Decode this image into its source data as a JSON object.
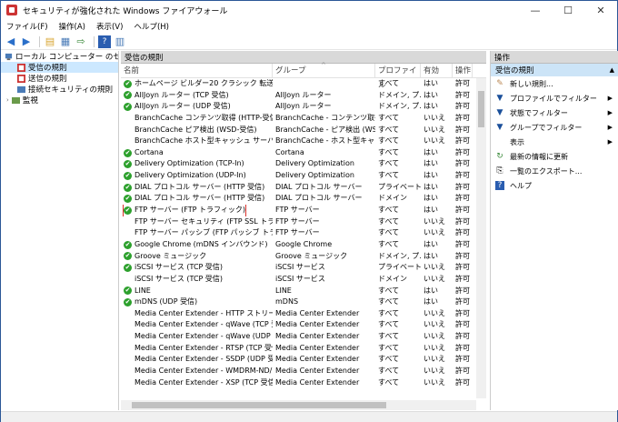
{
  "window": {
    "title": "セキュリティが強化された Windows ファイアウォール",
    "minimize": "—",
    "maximize": "☐",
    "close": "✕"
  },
  "menu": [
    "ファイル(F)",
    "操作(A)",
    "表示(V)",
    "ヘルプ(H)"
  ],
  "tree": {
    "root": "ローカル コンピューター のセキュリティ",
    "items": [
      "受信の規則",
      "送信の規則",
      "接続セキュリティの規則",
      "監視"
    ]
  },
  "center": {
    "header": "受信の規則",
    "columns": {
      "name": "名前",
      "group": "グループ",
      "profile": "プロファイル",
      "enabled": "有効",
      "action": "操作"
    },
    "sort_mark": "^",
    "rows": [
      {
        "enabled_icon": true,
        "name": "ホームページ ビルダー20 クラシック 転送予約ブ...",
        "group": "",
        "profile": "すべて",
        "enabled": "はい",
        "action": "許可"
      },
      {
        "enabled_icon": true,
        "name": "AllJoyn ルーター (TCP 受信)",
        "group": "AllJoyn ルーター",
        "profile": "ドメイン, プ...",
        "enabled": "はい",
        "action": "許可"
      },
      {
        "enabled_icon": true,
        "name": "AllJoyn ルーター (UDP 受信)",
        "group": "AllJoyn ルーター",
        "profile": "ドメイン, プ...",
        "enabled": "はい",
        "action": "許可"
      },
      {
        "enabled_icon": false,
        "name": "BranchCache コンテンツ取得 (HTTP-受信)",
        "group": "BranchCache - コンテンツ取得...",
        "profile": "すべて",
        "enabled": "いいえ",
        "action": "許可"
      },
      {
        "enabled_icon": false,
        "name": "BranchCache ピア検出 (WSD-受信)",
        "group": "BranchCache - ピア検出 (WS...",
        "profile": "すべて",
        "enabled": "いいえ",
        "action": "許可"
      },
      {
        "enabled_icon": false,
        "name": "BranchCache ホスト型キャッシュ サーバー (HT...",
        "group": "BranchCache - ホスト型キャッ...",
        "profile": "すべて",
        "enabled": "いいえ",
        "action": "許可"
      },
      {
        "enabled_icon": true,
        "name": "Cortana",
        "group": "Cortana",
        "profile": "すべて",
        "enabled": "はい",
        "action": "許可"
      },
      {
        "enabled_icon": true,
        "name": "Delivery Optimization (TCP-In)",
        "group": "Delivery Optimization",
        "profile": "すべて",
        "enabled": "はい",
        "action": "許可"
      },
      {
        "enabled_icon": true,
        "name": "Delivery Optimization (UDP-In)",
        "group": "Delivery Optimization",
        "profile": "すべて",
        "enabled": "はい",
        "action": "許可"
      },
      {
        "enabled_icon": true,
        "name": "DIAL プロトコル サーバー (HTTP 受信)",
        "group": "DIAL プロトコル サーバー",
        "profile": "プライベート",
        "enabled": "はい",
        "action": "許可"
      },
      {
        "enabled_icon": true,
        "name": "DIAL プロトコル サーバー (HTTP 受信)",
        "group": "DIAL プロトコル サーバー",
        "profile": "ドメイン",
        "enabled": "はい",
        "action": "許可"
      },
      {
        "enabled_icon": true,
        "name": "FTP サーバー (FTP トラフィック)",
        "group": "FTP サーバー",
        "profile": "すべて",
        "enabled": "はい",
        "action": "許可",
        "highlight": true
      },
      {
        "enabled_icon": false,
        "name": "FTP サーバー セキュリティ (FTP SSL トラフィック...",
        "group": "FTP サーバー",
        "profile": "すべて",
        "enabled": "いいえ",
        "action": "許可"
      },
      {
        "enabled_icon": false,
        "name": "FTP サーバー パッシブ (FTP パッシブ トラフィック...",
        "group": "FTP サーバー",
        "profile": "すべて",
        "enabled": "いいえ",
        "action": "許可"
      },
      {
        "enabled_icon": true,
        "name": "Google Chrome (mDNS インバウンド)",
        "group": "Google Chrome",
        "profile": "すべて",
        "enabled": "はい",
        "action": "許可"
      },
      {
        "enabled_icon": true,
        "name": "Groove ミュージック",
        "group": "Groove ミュージック",
        "profile": "ドメイン, プ...",
        "enabled": "はい",
        "action": "許可"
      },
      {
        "enabled_icon": true,
        "name": "iSCSI サービス (TCP 受信)",
        "group": "iSCSI サービス",
        "profile": "プライベート...",
        "enabled": "いいえ",
        "action": "許可"
      },
      {
        "enabled_icon": false,
        "name": "iSCSI サービス (TCP 受信)",
        "group": "iSCSI サービス",
        "profile": "ドメイン",
        "enabled": "いいえ",
        "action": "許可"
      },
      {
        "enabled_icon": true,
        "name": "LINE",
        "group": "LINE",
        "profile": "すべて",
        "enabled": "はい",
        "action": "許可"
      },
      {
        "enabled_icon": true,
        "name": "mDNS (UDP 受信)",
        "group": "mDNS",
        "profile": "すべて",
        "enabled": "はい",
        "action": "許可"
      },
      {
        "enabled_icon": false,
        "name": "Media Center Extender - HTTP ストリーミ...",
        "group": "Media Center Extender",
        "profile": "すべて",
        "enabled": "いいえ",
        "action": "許可"
      },
      {
        "enabled_icon": false,
        "name": "Media Center Extender - qWave (TCP 受信)",
        "group": "Media Center Extender",
        "profile": "すべて",
        "enabled": "いいえ",
        "action": "許可"
      },
      {
        "enabled_icon": false,
        "name": "Media Center Extender - qWave (UDP 受...",
        "group": "Media Center Extender",
        "profile": "すべて",
        "enabled": "いいえ",
        "action": "許可"
      },
      {
        "enabled_icon": false,
        "name": "Media Center Extender - RTSP (TCP 受信)",
        "group": "Media Center Extender",
        "profile": "すべて",
        "enabled": "いいえ",
        "action": "許可"
      },
      {
        "enabled_icon": false,
        "name": "Media Center Extender - SSDP (UDP 受信)",
        "group": "Media Center Extender",
        "profile": "すべて",
        "enabled": "いいえ",
        "action": "許可"
      },
      {
        "enabled_icon": false,
        "name": "Media Center Extender - WMDRM-ND/R...",
        "group": "Media Center Extender",
        "profile": "すべて",
        "enabled": "いいえ",
        "action": "許可"
      },
      {
        "enabled_icon": false,
        "name": "Media Center Extender - XSP (TCP 受信)",
        "group": "Media Center Extender",
        "profile": "すべて",
        "enabled": "いいえ",
        "action": "許可"
      }
    ]
  },
  "actions": {
    "header": "操作",
    "section": "受信の規則",
    "section_arrow": "▲",
    "items": [
      {
        "icon": "new-rule-icon",
        "glyph": "✎",
        "label": "新しい規則...",
        "submenu": false
      },
      {
        "icon": "filter-icon",
        "glyph": "▼",
        "label": "プロファイルでフィルター",
        "submenu": true
      },
      {
        "icon": "filter-icon",
        "glyph": "▼",
        "label": "状態でフィルター",
        "submenu": true
      },
      {
        "icon": "filter-icon",
        "glyph": "▼",
        "label": "グループでフィルター",
        "submenu": true
      },
      {
        "icon": "view-icon",
        "glyph": "",
        "label": "表示",
        "submenu": true
      },
      {
        "icon": "refresh-icon",
        "glyph": "↻",
        "label": "最新の情報に更新",
        "submenu": false
      },
      {
        "icon": "export-icon",
        "glyph": "⎘",
        "label": "一覧のエクスポート...",
        "submenu": false
      },
      {
        "icon": "help-icon",
        "glyph": "?",
        "label": "ヘルプ",
        "submenu": false
      }
    ]
  },
  "colors": {
    "accent": "#cce8ff",
    "highlight_border": "#d9302a",
    "enabled_green": "#2ca02c"
  }
}
